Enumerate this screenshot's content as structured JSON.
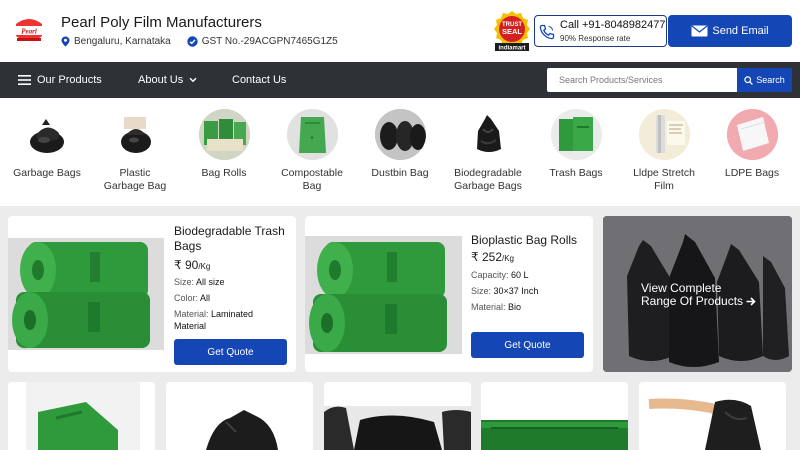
{
  "header": {
    "logo_text": "Pearl",
    "company_name": "Pearl Poly Film Manufacturers",
    "location": "Bengaluru, Karnataka",
    "gst": "GST No.-29ACGPN7465G1Z5",
    "trust_seal": {
      "top": "TRUST",
      "main": "SEAL",
      "brand": "indiamart"
    },
    "call_label": "Call +91-8048982477",
    "response_rate": "90% Response rate",
    "email_button": "Send Email"
  },
  "nav": {
    "items": [
      {
        "label": "Our Products",
        "icon": "hamburger-icon"
      },
      {
        "label": "About Us",
        "icon": "chevron-down-icon"
      },
      {
        "label": "Contact Us"
      }
    ],
    "search_placeholder": "Search Products/Services",
    "search_button": "Search"
  },
  "categories": [
    {
      "line1": "Garbage Bags",
      "line2": ""
    },
    {
      "line1": "Plastic",
      "line2": "Garbage Bag"
    },
    {
      "line1": "Bag Rolls",
      "line2": ""
    },
    {
      "line1": "Compostable",
      "line2": "Bag"
    },
    {
      "line1": "Dustbin Bag",
      "line2": ""
    },
    {
      "line1": "Biodegradable",
      "line2": "Garbage Bags"
    },
    {
      "line1": "Trash Bags",
      "line2": ""
    },
    {
      "line1": "Lldpe Stretch",
      "line2": "Film"
    },
    {
      "line1": "LDPE Bags",
      "line2": ""
    }
  ],
  "products": [
    {
      "title_line1": "Biodegradable Trash",
      "title_line2": "Bags",
      "price": "₹ 90",
      "unit": "/Kg",
      "attrs": [
        {
          "key": "Size:",
          "value": "All size"
        },
        {
          "key": "Color:",
          "value": "All"
        },
        {
          "key": "Material:",
          "value": "Laminated"
        }
      ],
      "attr_wrap": "Material",
      "quote_label": "Get Quote"
    },
    {
      "title_line1": "Bioplastic Bag Rolls",
      "price": "₹ 252",
      "unit": "/Kg",
      "attrs": [
        {
          "key": "Capacity:",
          "value": "60 L"
        },
        {
          "key": "Size:",
          "value": "30×37 Inch"
        },
        {
          "key": "Material:",
          "value": "Bio"
        }
      ],
      "quote_label": "Get Quote"
    }
  ],
  "range": {
    "line1": "View Complete",
    "line2": "Range Of Products"
  },
  "colors": {
    "primary": "#1447b5",
    "nav_bg": "#2e3237",
    "bag_green": "#2e9a3c",
    "page_bg": "#ececec"
  }
}
